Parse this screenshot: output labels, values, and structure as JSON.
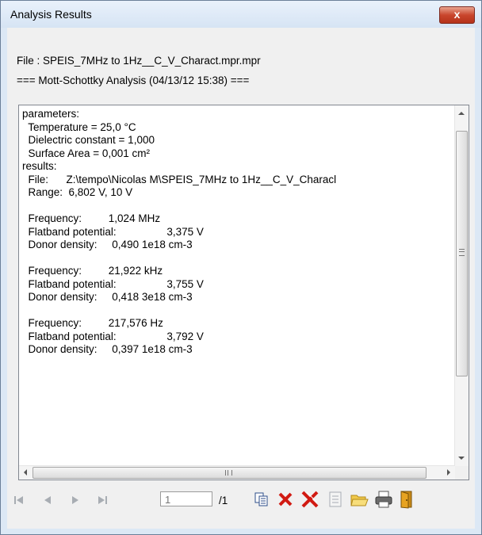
{
  "window": {
    "title": "Analysis Results",
    "close_label": "x"
  },
  "file_line": "File : SPEIS_7MHz to 1Hz__C_V_Charact.mpr.mpr",
  "analysis_line": "=== Mott-Schottky Analysis (04/13/12 15:38) ===",
  "results_lines": [
    "parameters:",
    "  Temperature = 25,0 °C",
    "  Dielectric constant = 1,000",
    "  Surface Area = 0,001 cm²",
    "results:",
    "  File:      Z:\\tempo\\Nicolas M\\SPEIS_7MHz to 1Hz__C_V_Characl",
    "  Range:  6,802 V, 10 V",
    "",
    "  Frequency:         1,024 MHz",
    "  Flatband potential:                 3,375 V",
    "  Donor density:     0,490 1e18 cm-3",
    "",
    "  Frequency:         21,922 kHz",
    "  Flatband potential:                 3,755 V",
    "  Donor density:     0,418 3e18 cm-3",
    "",
    "  Frequency:         217,576 Hz",
    "  Flatband potential:                 3,792 V",
    "  Donor density:     0,397 1e18 cm-3"
  ],
  "toolbar": {
    "page_value": "1",
    "page_total": "/1",
    "icons": [
      "first-page-icon",
      "previous-page-icon",
      "next-page-icon",
      "last-page-icon",
      "copy-icon",
      "delete-icon",
      "delete-all-icon",
      "notes-icon",
      "open-folder-icon",
      "print-icon",
      "exit-icon"
    ]
  },
  "colors": {
    "accent_red": "#d11a12",
    "window_bg": "#dce8f5"
  }
}
